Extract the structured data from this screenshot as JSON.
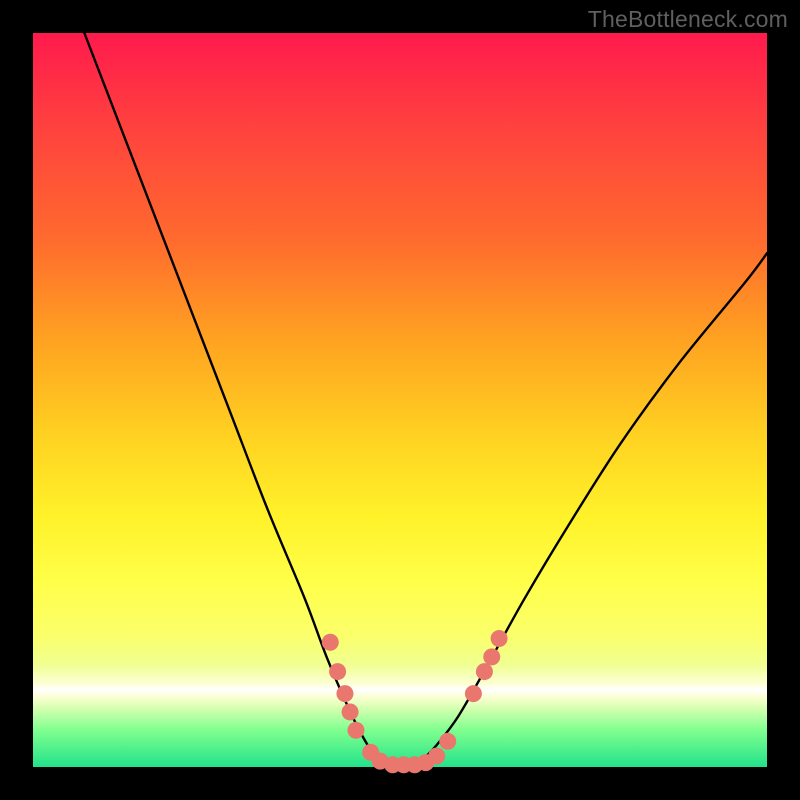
{
  "watermark": "TheBottleneck.com",
  "colors": {
    "frame": "#000000",
    "curve": "#000000",
    "dots": "#e9776e"
  },
  "chart_data": {
    "type": "line",
    "title": "",
    "xlabel": "",
    "ylabel": "",
    "xlim": [
      0,
      100
    ],
    "ylim": [
      0,
      100
    ],
    "grid": false,
    "legend": false,
    "series": [
      {
        "name": "bottleneck-curve",
        "x": [
          7,
          12,
          17,
          22,
          27,
          32,
          37,
          40,
          43,
          45,
          47,
          49,
          51,
          53,
          55,
          58,
          62,
          67,
          73,
          80,
          88,
          97,
          100
        ],
        "y": [
          100,
          87,
          74,
          61,
          48,
          35,
          23,
          15,
          8,
          4,
          1,
          0,
          0,
          1,
          3,
          7,
          14,
          23,
          33,
          44,
          55,
          66,
          70
        ]
      }
    ],
    "markers": [
      {
        "x": 40.5,
        "y": 17
      },
      {
        "x": 41.5,
        "y": 13
      },
      {
        "x": 42.5,
        "y": 10
      },
      {
        "x": 43.2,
        "y": 7.5
      },
      {
        "x": 44.0,
        "y": 5
      },
      {
        "x": 46.0,
        "y": 2
      },
      {
        "x": 47.3,
        "y": 0.8
      },
      {
        "x": 49.0,
        "y": 0.3
      },
      {
        "x": 50.5,
        "y": 0.3
      },
      {
        "x": 52.0,
        "y": 0.3
      },
      {
        "x": 53.5,
        "y": 0.6
      },
      {
        "x": 55.0,
        "y": 1.5
      },
      {
        "x": 56.5,
        "y": 3.5
      },
      {
        "x": 60.0,
        "y": 10
      },
      {
        "x": 61.5,
        "y": 13
      },
      {
        "x": 62.5,
        "y": 15
      },
      {
        "x": 63.5,
        "y": 17.5
      }
    ]
  }
}
